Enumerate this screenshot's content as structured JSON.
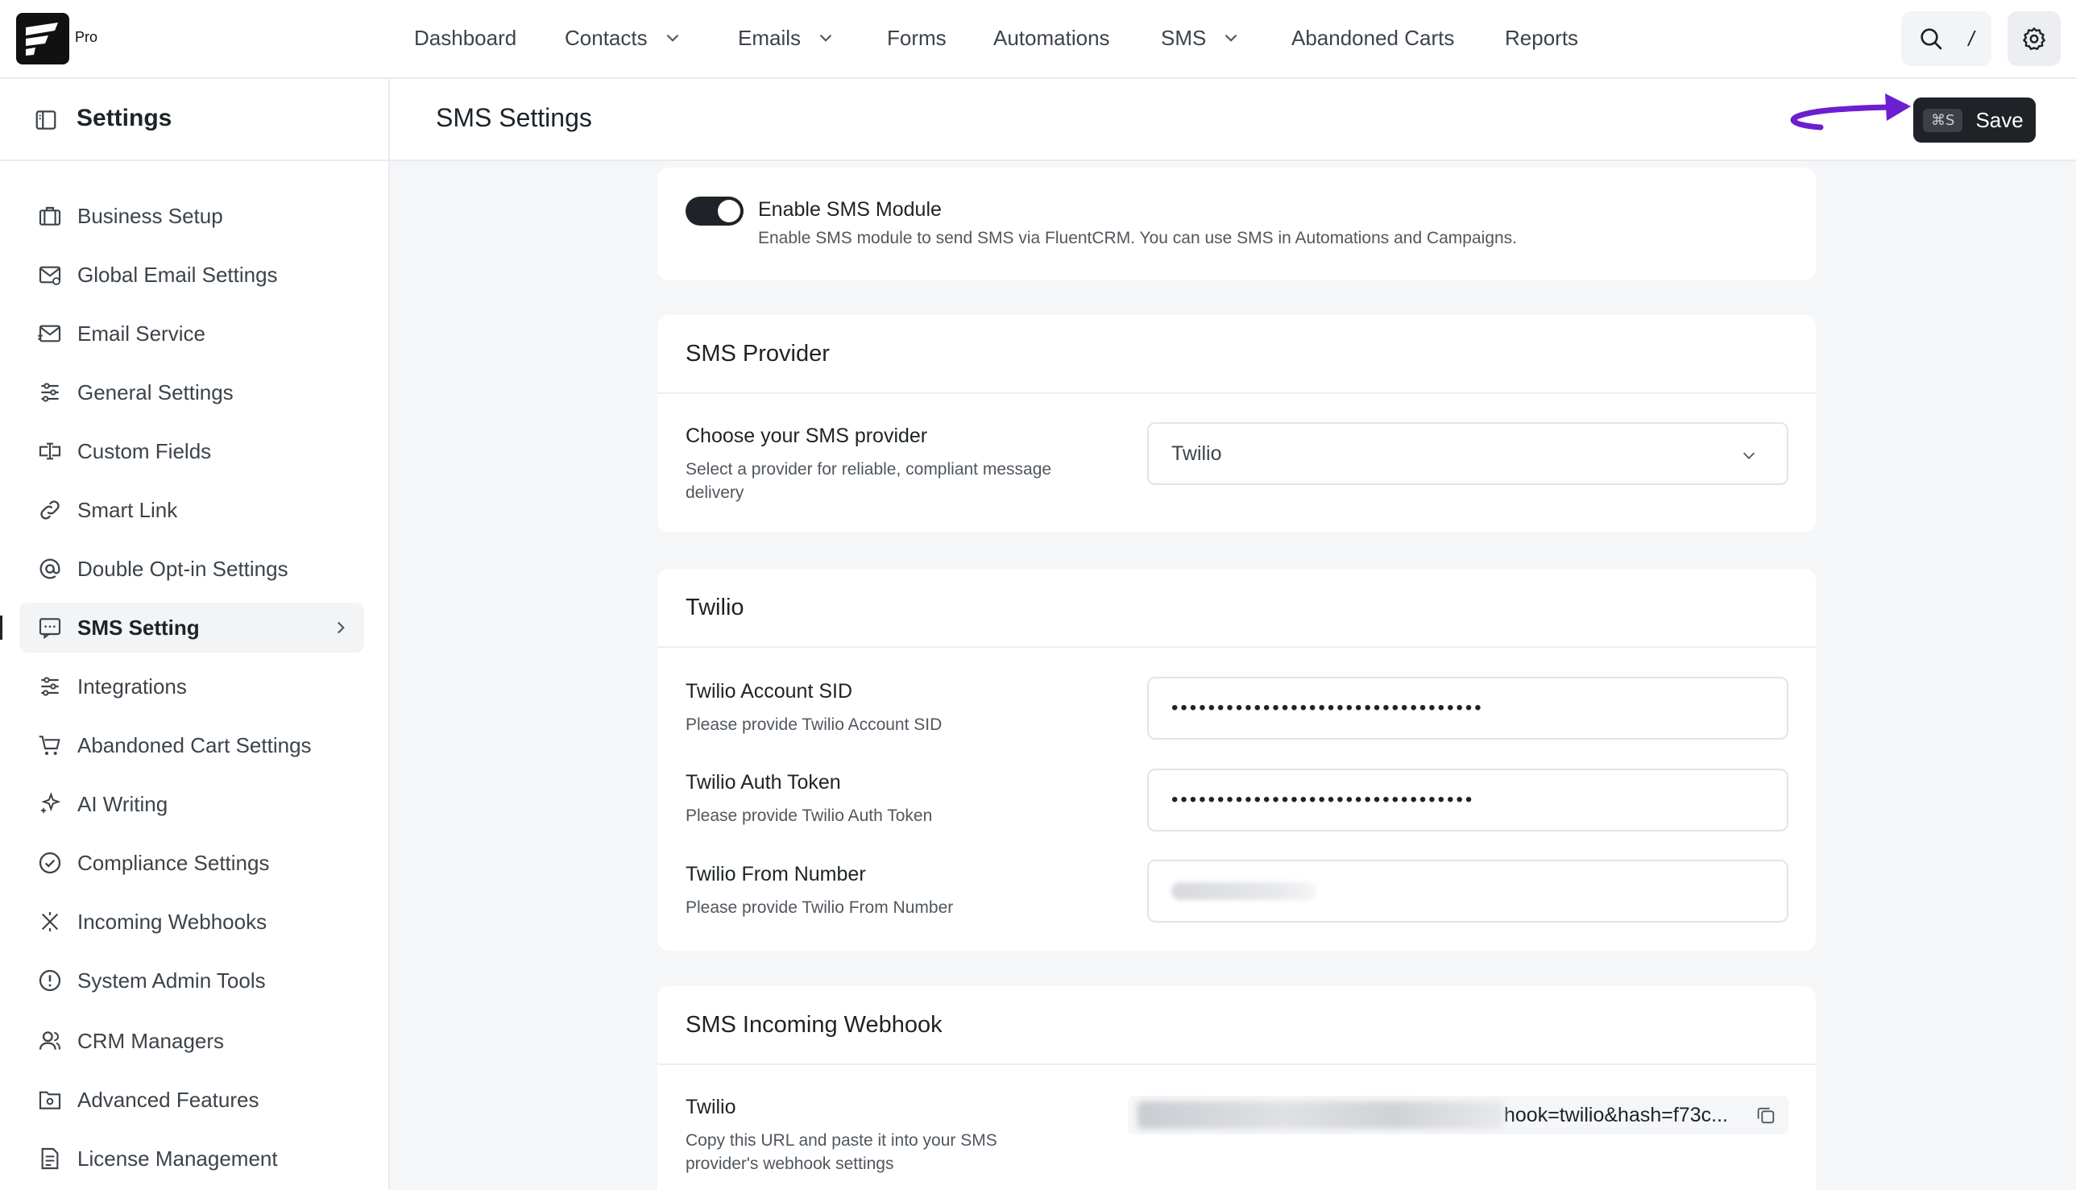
{
  "brand": {
    "badge": "Pro"
  },
  "nav": {
    "items": [
      {
        "label": "Dashboard",
        "dropdown": false
      },
      {
        "label": "Contacts",
        "dropdown": true
      },
      {
        "label": "Emails",
        "dropdown": true
      },
      {
        "label": "Forms",
        "dropdown": false
      },
      {
        "label": "Automations",
        "dropdown": false
      },
      {
        "label": "SMS",
        "dropdown": true
      },
      {
        "label": "Abandoned Carts",
        "dropdown": false
      },
      {
        "label": "Reports",
        "dropdown": false
      }
    ],
    "search_shortcut": "/"
  },
  "sidebar": {
    "title": "Settings",
    "items": [
      {
        "label": "Business Setup",
        "icon": "briefcase-icon"
      },
      {
        "label": "Global Email Settings",
        "icon": "mail-settings-icon"
      },
      {
        "label": "Email Service",
        "icon": "mail-send-icon"
      },
      {
        "label": "General Settings",
        "icon": "sliders-icon"
      },
      {
        "label": "Custom Fields",
        "icon": "text-cursor-icon"
      },
      {
        "label": "Smart Link",
        "icon": "link-icon"
      },
      {
        "label": "Double Opt-in Settings",
        "icon": "at-sign-icon"
      },
      {
        "label": "SMS Setting",
        "icon": "message-icon",
        "active": true
      },
      {
        "label": "Integrations",
        "icon": "sliders-icon"
      },
      {
        "label": "Abandoned Cart Settings",
        "icon": "cart-icon"
      },
      {
        "label": "AI Writing",
        "icon": "sparkles-icon"
      },
      {
        "label": "Compliance Settings",
        "icon": "check-circle-icon"
      },
      {
        "label": "Incoming Webhooks",
        "icon": "webhook-icon"
      },
      {
        "label": "System Admin Tools",
        "icon": "alert-circle-icon"
      },
      {
        "label": "CRM Managers",
        "icon": "users-icon"
      },
      {
        "label": "Advanced Features",
        "icon": "folder-icon"
      },
      {
        "label": "License Management",
        "icon": "document-icon"
      }
    ]
  },
  "main": {
    "title": "SMS Settings",
    "save": {
      "shortcut": "⌘S",
      "label": "Save"
    }
  },
  "enable_card": {
    "title": "Enable SMS Module",
    "description": "Enable SMS module to send SMS via FluentCRM. You can use SMS in Automations and Campaigns.",
    "enabled": true
  },
  "provider_card": {
    "title": "SMS Provider",
    "label": "Choose your SMS provider",
    "help_line1": "Select a provider for reliable, compliant message",
    "help_line2": "delivery",
    "selected": "Twilio"
  },
  "twilio_card": {
    "title": "Twilio",
    "fields": [
      {
        "label": "Twilio Account SID",
        "help": "Please provide Twilio Account SID",
        "value": "••••••••••••••••••••••••••••••••••"
      },
      {
        "label": "Twilio Auth Token",
        "help": "Please provide Twilio Auth Token",
        "value": "•••••••••••••••••••••••••••••••••"
      },
      {
        "label": "Twilio From Number",
        "help": "Please provide Twilio From Number",
        "value": ""
      }
    ]
  },
  "webhook_card": {
    "title": "SMS Incoming Webhook",
    "label": "Twilio",
    "help_line1": "Copy this URL and paste it into your SMS",
    "help_line2": "provider's webhook settings",
    "url_visible": "hook=twilio&hash=f73c..."
  },
  "colors": {
    "accent": "#1f2328",
    "annotation_arrow": "#6b1fd1"
  }
}
